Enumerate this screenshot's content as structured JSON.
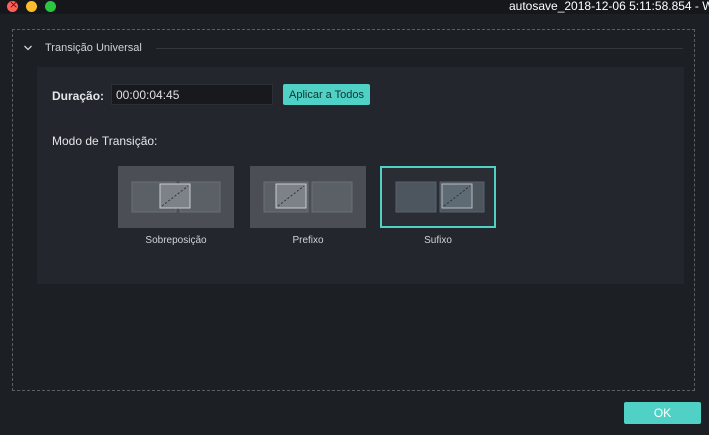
{
  "window": {
    "title": "autosave_2018-12-06 5:11:58.854 - W"
  },
  "section": {
    "title": "Transição Universal",
    "icon": "chevron-down-icon"
  },
  "duration": {
    "label": "Duração:",
    "value": "00:00:04:45",
    "apply_label": "Aplicar a Todos"
  },
  "mode": {
    "label": "Modo de Transição:",
    "options": [
      {
        "label": "Sobreposição",
        "selected": false
      },
      {
        "label": "Prefixo",
        "selected": false
      },
      {
        "label": "Sufixo",
        "selected": true
      }
    ]
  },
  "footer": {
    "ok_label": "OK"
  },
  "colors": {
    "accent": "#4fd1c5",
    "background": "#1c1f24",
    "panel": "#23262c"
  }
}
